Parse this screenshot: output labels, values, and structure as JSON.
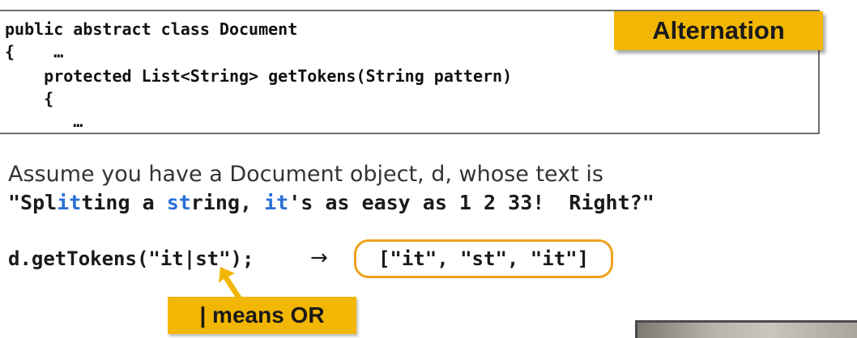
{
  "slide": {
    "title_tag": "Alternation",
    "code": {
      "line1": "public abstract class Document",
      "line2": "{    …",
      "line3": "    protected List<String> getTokens(String pattern)",
      "line4": "    {",
      "line5": "       …"
    },
    "assume": "Assume you have a Document object, d, whose text is",
    "example": {
      "seg1": "\"Spl",
      "seg2": "it",
      "seg3": "ting a ",
      "seg4": "st",
      "seg5": "ring, ",
      "seg6": "it",
      "seg7": "'s as easy as 1 2 33!  Right?\""
    },
    "call": "d.getTokens(\"it|st\");",
    "arrow": "→",
    "result": "[\"it\", \"st\", \"it\"]",
    "note": "| means OR"
  },
  "colors": {
    "accent_yellow": "#f2b705",
    "result_border": "#f0a11b",
    "match_highlight": "#2a6fd6"
  },
  "icons": {
    "pointer": "arrow-up-pointer-icon",
    "arrow": "right-arrow-icon"
  }
}
